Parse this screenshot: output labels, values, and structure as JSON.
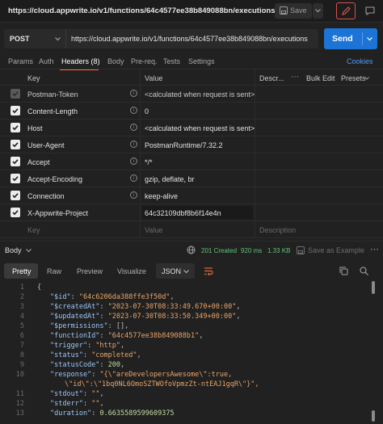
{
  "top": {
    "title": "https://cloud.appwrite.io/v1/functions/64c4577ee38b849088bn/executions",
    "save_label": "Save"
  },
  "request": {
    "method": "POST",
    "url": "https://cloud.appwrite.io/v1/functions/64c4577ee38b849088bn/executions",
    "send_label": "Send"
  },
  "tabs": [
    {
      "label": "Params"
    },
    {
      "label": "Auth"
    },
    {
      "label": "Headers (8)"
    },
    {
      "label": "Body"
    },
    {
      "label": "Pre-req."
    },
    {
      "label": "Tests"
    },
    {
      "label": "Settings"
    }
  ],
  "cookies_label": "Cookies",
  "headers_table": {
    "col_key": "Key",
    "col_value": "Value",
    "col_desc": "Descr...",
    "bulk_edit": "Bulk Edit",
    "presets": "Presets",
    "rows": [
      {
        "key": "Postman-Token",
        "value": "<calculated when request is sent>"
      },
      {
        "key": "Content-Length",
        "value": "0"
      },
      {
        "key": "Host",
        "value": "<calculated when request is sent>"
      },
      {
        "key": "User-Agent",
        "value": "PostmanRuntime/7.32.2"
      },
      {
        "key": "Accept",
        "value": "*/*"
      },
      {
        "key": "Accept-Encoding",
        "value": "gzip, deflate, br"
      },
      {
        "key": "Connection",
        "value": "keep-alive"
      },
      {
        "key": "X-Appwrite-Project",
        "value": "64c32109dbf8b6f14e4n"
      }
    ],
    "placeholder_key": "Key",
    "placeholder_value": "Value",
    "placeholder_desc": "Description"
  },
  "response": {
    "body_label": "Body",
    "status": "201 Created",
    "time": "920 ms",
    "size": "1.33 KB",
    "save_example": "Save as Example",
    "views": [
      "Pretty",
      "Raw",
      "Preview",
      "Visualize"
    ],
    "format": "JSON"
  },
  "code_lines": [
    {
      "num": "1",
      "text": "{"
    },
    {
      "num": "2",
      "key": "\"$id\"",
      "value": "\"64c6206da388ffe3f50d\"",
      "tail": ","
    },
    {
      "num": "3",
      "key": "\"$createdAt\"",
      "value": "\"2023-07-30T08:33:49.670+00:00\"",
      "tail": ","
    },
    {
      "num": "4",
      "key": "\"$updatedAt\"",
      "value": "\"2023-07-30T08:33:50.349+00:00\"",
      "tail": ","
    },
    {
      "num": "5",
      "key": "\"$permissions\"",
      "value": "[]",
      "tail": ","
    },
    {
      "num": "6",
      "key": "\"functionId\"",
      "value": "\"64c4577ee38b849088b1\"",
      "tail": ","
    },
    {
      "num": "7",
      "key": "\"trigger\"",
      "value": "\"http\"",
      "tail": ","
    },
    {
      "num": "8",
      "key": "\"status\"",
      "value": "\"completed\"",
      "tail": ","
    },
    {
      "num": "9",
      "key": "\"statusCode\"",
      "value": "200",
      "tail": ","
    },
    {
      "num": "10",
      "key": "\"response\"",
      "value": "\"{\\\"areDevelopersAwesome\\\":true,",
      "tail": ""
    },
    {
      "num": "",
      "text": "\\\"id\\\":\\\"1bq0NL6OmoSZTWOfoVpmzZt-ntEAJ1gqR\\\"}\","
    },
    {
      "num": "11",
      "key": "\"stdout\"",
      "value": "\"\"",
      "tail": ","
    },
    {
      "num": "12",
      "key": "\"stderr\"",
      "value": "\"\"",
      "tail": ","
    },
    {
      "num": "13",
      "key": "\"duration\"",
      "value": "0.6635589599609375",
      "tail": ""
    }
  ]
}
